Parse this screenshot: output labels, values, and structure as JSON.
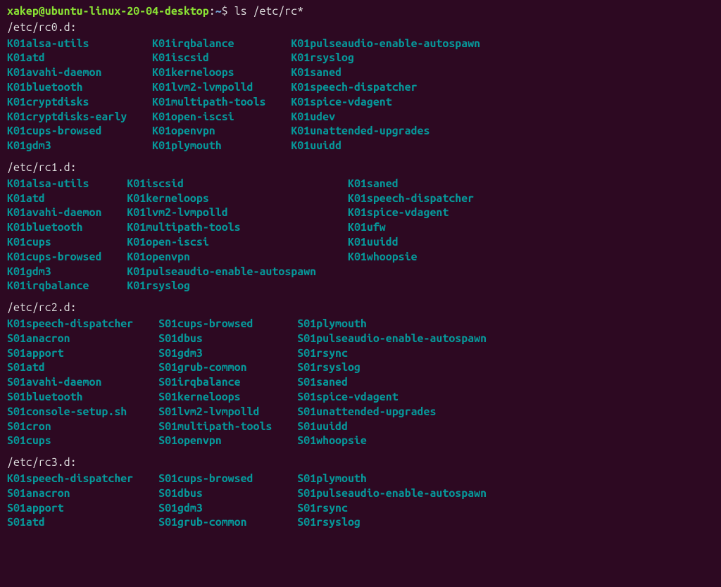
{
  "prompt": {
    "user_host": "xakep@ubuntu-linux-20-04-desktop",
    "colon": ":",
    "path": "~",
    "dollar": "$",
    "command": "ls /etc/rc*"
  },
  "sections": [
    {
      "header": "/etc/rc0.d:",
      "col_widths": [
        "21ch",
        "20ch",
        "auto"
      ],
      "rows": [
        [
          "K01alsa-utils",
          "K01irqbalance",
          "K01pulseaudio-enable-autospawn"
        ],
        [
          "K01atd",
          "K01iscsid",
          "K01rsyslog"
        ],
        [
          "K01avahi-daemon",
          "K01kerneloops",
          "K01saned"
        ],
        [
          "K01bluetooth",
          "K01lvm2-lvmpolld",
          "K01speech-dispatcher"
        ],
        [
          "K01cryptdisks",
          "K01multipath-tools",
          "K01spice-vdagent"
        ],
        [
          "K01cryptdisks-early",
          "K01open-iscsi",
          "K01udev"
        ],
        [
          "K01cups-browsed",
          "K01openvpn",
          "K01unattended-upgrades"
        ],
        [
          "K01gdm3",
          "K01plymouth",
          "K01uuidd"
        ]
      ]
    },
    {
      "header": "/etc/rc1.d:",
      "col_widths": [
        "17ch",
        "33ch",
        "auto"
      ],
      "rows": [
        [
          "K01alsa-utils",
          "K01iscsid",
          "K01saned"
        ],
        [
          "K01atd",
          "K01kerneloops",
          "K01speech-dispatcher"
        ],
        [
          "K01avahi-daemon",
          "K01lvm2-lvmpolld",
          "K01spice-vdagent"
        ],
        [
          "K01bluetooth",
          "K01multipath-tools",
          "K01ufw"
        ],
        [
          "K01cups",
          "K01open-iscsi",
          "K01uuidd"
        ],
        [
          "K01cups-browsed",
          "K01openvpn",
          "K01whoopsie"
        ],
        [
          "K01gdm3",
          "K01pulseaudio-enable-autospawn",
          ""
        ],
        [
          "K01irqbalance",
          "K01rsyslog",
          ""
        ]
      ]
    },
    {
      "header": "/etc/rc2.d:",
      "col_widths": [
        "22ch",
        "20ch",
        "auto"
      ],
      "rows": [
        [
          "K01speech-dispatcher",
          "S01cups-browsed",
          "S01plymouth"
        ],
        [
          "S01anacron",
          "S01dbus",
          "S01pulseaudio-enable-autospawn"
        ],
        [
          "S01apport",
          "S01gdm3",
          "S01rsync"
        ],
        [
          "S01atd",
          "S01grub-common",
          "S01rsyslog"
        ],
        [
          "S01avahi-daemon",
          "S01irqbalance",
          "S01saned"
        ],
        [
          "S01bluetooth",
          "S01kerneloops",
          "S01spice-vdagent"
        ],
        [
          "S01console-setup.sh",
          "S01lvm2-lvmpolld",
          "S01unattended-upgrades"
        ],
        [
          "S01cron",
          "S01multipath-tools",
          "S01uuidd"
        ],
        [
          "S01cups",
          "S01openvpn",
          "S01whoopsie"
        ]
      ]
    },
    {
      "header": "/etc/rc3.d:",
      "col_widths": [
        "22ch",
        "20ch",
        "auto"
      ],
      "rows": [
        [
          "K01speech-dispatcher",
          "S01cups-browsed",
          "S01plymouth"
        ],
        [
          "S01anacron",
          "S01dbus",
          "S01pulseaudio-enable-autospawn"
        ],
        [
          "S01apport",
          "S01gdm3",
          "S01rsync"
        ],
        [
          "S01atd",
          "S01grub-common",
          "S01rsyslog"
        ]
      ]
    }
  ]
}
